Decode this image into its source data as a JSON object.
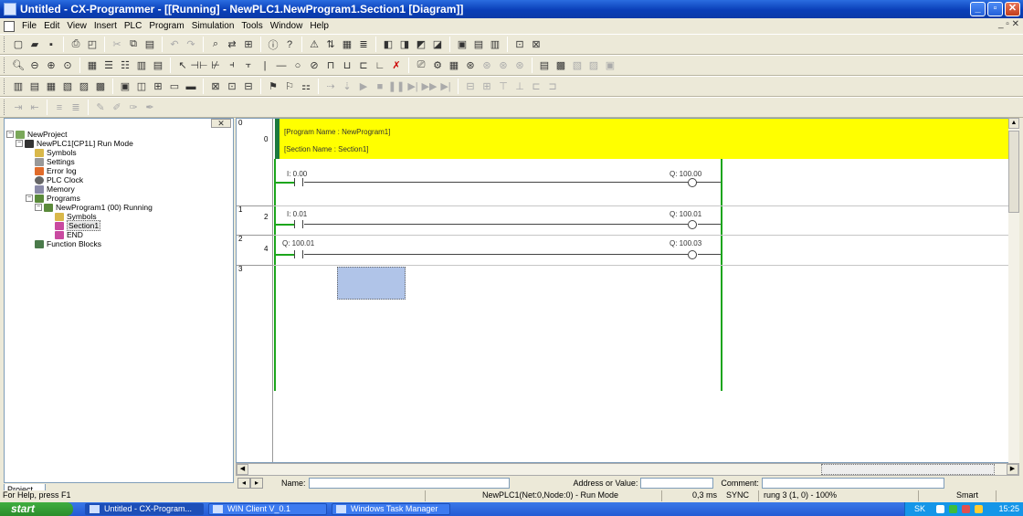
{
  "window": {
    "title": "Untitled - CX-Programmer - [[Running] - NewPLC1.NewProgram1.Section1 [Diagram]]"
  },
  "menu": [
    "File",
    "Edit",
    "View",
    "Insert",
    "PLC",
    "Program",
    "Simulation",
    "Tools",
    "Window",
    "Help"
  ],
  "project_tree": {
    "root": "NewProject",
    "plc": "NewPLC1[CP1L] Run Mode",
    "items": [
      "Symbols",
      "Settings",
      "Error log",
      "PLC Clock",
      "Memory",
      "Programs"
    ],
    "program": "NewProgram1 (00) Running",
    "program_items": [
      "Symbols",
      "Section1",
      "END"
    ],
    "function_blocks": "Function Blocks",
    "tab_label": "Project"
  },
  "ladder": {
    "rung_numbers": [
      "0",
      "1",
      "2",
      "3"
    ],
    "step_numbers": [
      "0",
      "2",
      "4"
    ],
    "program_name": "[Program Name : NewProgram1]",
    "section_name": "[Section Name : Section1]",
    "rungs": [
      {
        "contact": "I: 0.00",
        "coil": "Q: 100.00"
      },
      {
        "contact": "I: 0.01",
        "coil": "Q: 100.01"
      },
      {
        "contact": "Q: 100.01",
        "coil": "Q: 100.03"
      }
    ]
  },
  "info_bar": {
    "name_label": "Name:",
    "address_label": "Address or Value:",
    "comment_label": "Comment:"
  },
  "status_bar": {
    "help": "For Help, press F1",
    "connection": "NewPLC1(Net:0,Node:0) - Run Mode",
    "cycle": "0,3 ms",
    "sync": "SYNC",
    "position": "rung 3 (1, 0) - 100%",
    "mode": "Smart"
  },
  "taskbar": {
    "start": "start",
    "tasks": [
      "Untitled - CX-Program...",
      "WIN Client V_0.1",
      "Windows Task Manager"
    ],
    "lang": "SK",
    "clock": "15:25"
  },
  "colors": {
    "comment_band": "#ffff00",
    "rail": "#1ca51c",
    "title_bar": "#0a3fb8"
  }
}
